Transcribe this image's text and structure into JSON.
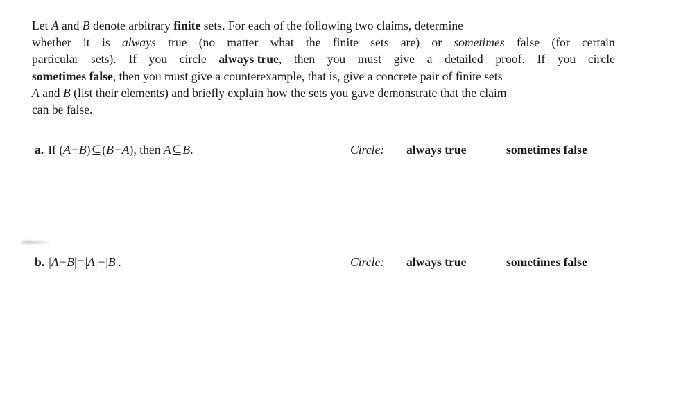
{
  "document": {
    "background_color": "#ffffff",
    "text_color": "#1b1b1b"
  },
  "intro": {
    "full_text": "Let A and B denote arbitrary finite sets. For each of the following two claims, determine whether it is always true (no matter what the finite sets are) or sometimes false (for certain particular sets). If you circle always true, then you must give a detailed proof. If you circle sometimes false, then you must give a counterexample, that is, give a concrete pair of finite sets A and B (list their elements) and briefly explain how the sets you gave demonstrate that the claim can be false.",
    "line1": {
      "s1": "Let ",
      "var_a": "A",
      "s2": " and ",
      "var_b": "B",
      "s3": " denote arbitrary ",
      "bold_finite": "finite",
      "s4": " sets.  For each of the following two claims, determine"
    },
    "line2": {
      "s1": "whether",
      "s2": "it",
      "s3": "is",
      "em_always": "always",
      "s4": "true",
      "s5": "(no",
      "s6": "matter",
      "s7": "what",
      "s8": "the",
      "s9": "finite",
      "s10": "sets",
      "s11": "are)",
      "s12": "or",
      "em_sometimes": "sometimes",
      "s13": "false",
      "s14": "(for",
      "s15": "certain"
    },
    "line3": {
      "s1": "particular",
      "s2": "sets).",
      "s3": "If",
      "s4": "you",
      "s5": "circle",
      "bold_always_true": "always true",
      "s6": ",",
      "s7": "then",
      "s8": "you",
      "s9": "must",
      "s10": "give",
      "s11": "a",
      "s12": "detailed",
      "s13": "proof.",
      "s14": "If",
      "s15": "you",
      "s16": "circle"
    },
    "line4": {
      "bold_sometimes_false": "sometimes false",
      "s1": ", then you must give a counterexample, that is, give a concrete pair of finite sets"
    },
    "line5": {
      "var_a": "A",
      "s1": " and ",
      "var_b": "B",
      "s2": " (list their elements) and briefly explain how the sets you gave demonstrate that the claim"
    },
    "line6": {
      "s1": "can be false."
    }
  },
  "items": [
    {
      "label": "a.",
      "claim_text": "If (A − B) ⊆ (B − A), then A ⊆ B.",
      "claim": {
        "lead": "If",
        "open1": "(",
        "var_a1": "A",
        "minus1": "−",
        "var_b1": "B",
        "close1": ")",
        "subset1": "⊆",
        "open2": "(",
        "var_b2": "B",
        "minus2": "−",
        "var_a2": "A",
        "close2": ")",
        "comma": ",",
        "then": "then",
        "var_a3": "A",
        "subset2": "⊆",
        "var_b3": "B",
        "period": "."
      },
      "circle": {
        "label": "Circle:",
        "option_true": "always true",
        "option_false": "sometimes false"
      }
    },
    {
      "label": "b.",
      "claim_text": "|A − B| = |A| − |B|.",
      "claim": {
        "bar1": "|",
        "var_a1": "A",
        "minus1": "−",
        "var_b1": "B",
        "bar2": "|",
        "equals": "=",
        "bar3": "|",
        "var_a2": "A",
        "bar4": "|",
        "minus2": "−",
        "bar5": "|",
        "var_b2": "B",
        "bar6": "|",
        "period": "."
      },
      "circle": {
        "label": "Circle:",
        "option_true": "always true",
        "option_false": "sometimes false"
      }
    }
  ]
}
